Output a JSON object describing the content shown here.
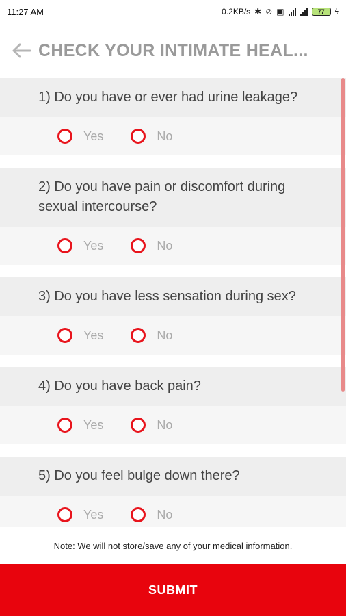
{
  "status_bar": {
    "time": "11:27 AM",
    "net_speed": "0.2KB/s",
    "battery": "77"
  },
  "header": {
    "title": "CHECK YOUR INTIMATE HEAL..."
  },
  "options": {
    "yes": "Yes",
    "no": "No"
  },
  "questions": [
    {
      "text": "1) Do you have or ever had urine leakage?"
    },
    {
      "text": "2) Do you have pain or discomfort during sexual intercourse?"
    },
    {
      "text": "3) Do you have less sensation during sex?"
    },
    {
      "text": "4) Do you have back pain?"
    },
    {
      "text": "5) Do you feel bulge down there?"
    }
  ],
  "note": "Note: We will not store/save any of your medical information.",
  "submit_label": "SUBMIT",
  "colors": {
    "accent": "#e8040d",
    "title": "#9a9a9a",
    "option_text": "#aaaaaa"
  }
}
